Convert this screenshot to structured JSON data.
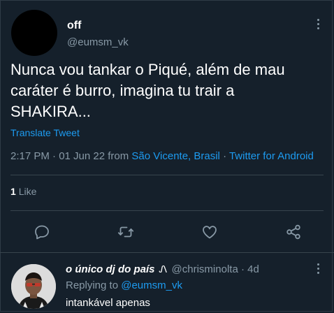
{
  "tweet": {
    "display_name": "off",
    "handle": "@eumsm_vk",
    "text_lines": [
      "Nunca vou tankar o Piqué, além de mau",
      "caráter é burro, imagina tu trair a",
      "SHAKIRA..."
    ],
    "translate_label": "Translate Tweet",
    "time": "2:17 PM · 01 Jun 22 from",
    "location": "São Vicente, Brasil",
    "separator": "·",
    "source": "Twitter for Android",
    "like_count": "1",
    "like_label": "Like"
  },
  "actions": [
    {
      "name": "reply-icon"
    },
    {
      "name": "retweet-icon"
    },
    {
      "name": "like-icon"
    },
    {
      "name": "share-icon"
    }
  ],
  "reply": {
    "display_name": "o único dj do país",
    "name_mark": "Ꮑ",
    "handle": "@chrisminolta",
    "separator": "·",
    "age": "4d",
    "replying_prefix": "Replying to",
    "replying_to": "@eumsm_vk",
    "text": "intankável apenas"
  },
  "colors": {
    "background": "#15202b",
    "accent": "#1d9bf0",
    "muted": "#8899a6",
    "divider": "#38444d"
  }
}
